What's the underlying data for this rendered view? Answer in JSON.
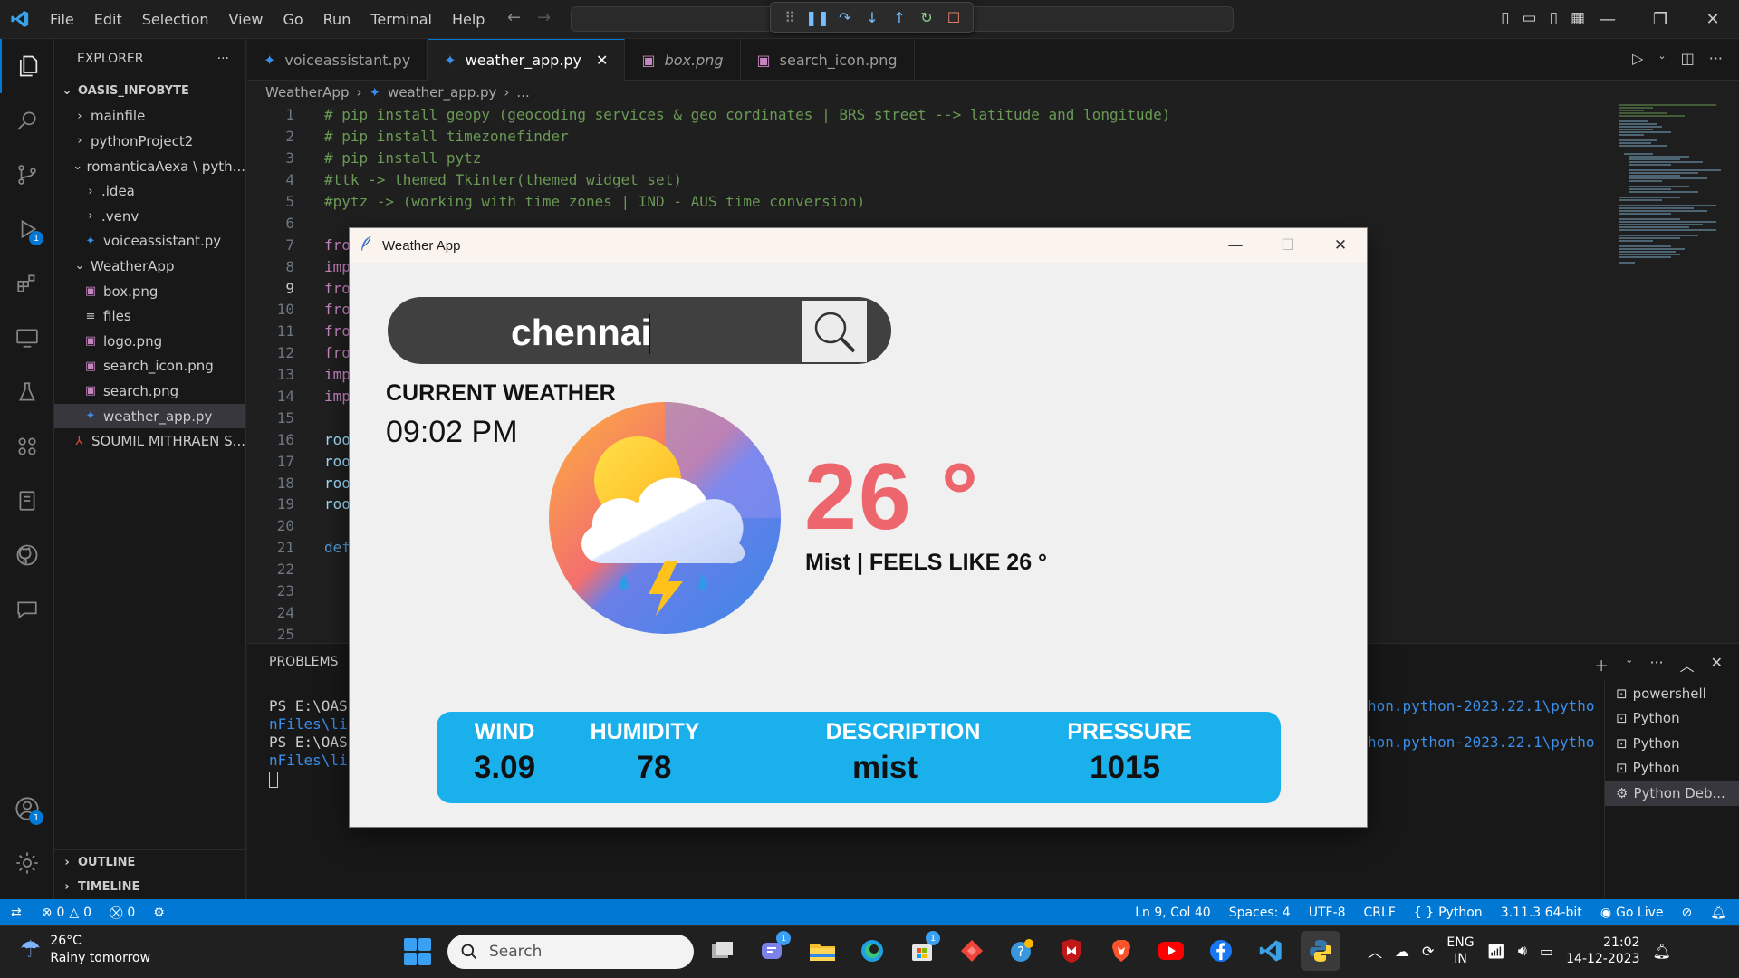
{
  "titlebar": {
    "menu": [
      "File",
      "Edit",
      "Selection",
      "View",
      "Go",
      "Run",
      "Terminal",
      "Help"
    ]
  },
  "activity": {
    "debug_badge": "1",
    "account_badge": "1"
  },
  "explorer": {
    "title": "EXPLORER",
    "more": "···",
    "root": "OASIS_INFOBYTE",
    "tree": [
      {
        "label": "mainfile",
        "kind": "folder-closed",
        "depth": 1
      },
      {
        "label": "pythonProject2",
        "kind": "folder-closed",
        "depth": 1
      },
      {
        "label": "romanticaAexa \\ pyth...",
        "kind": "folder-open",
        "depth": 1
      },
      {
        "label": ".idea",
        "kind": "folder-closed",
        "depth": 2
      },
      {
        "label": ".venv",
        "kind": "folder-closed",
        "depth": 2
      },
      {
        "label": "voiceassistant.py",
        "kind": "py",
        "depth": 2
      },
      {
        "label": "WeatherApp",
        "kind": "folder-open",
        "depth": 1
      },
      {
        "label": "box.png",
        "kind": "png",
        "depth": 2
      },
      {
        "label": "files",
        "kind": "txt",
        "depth": 2
      },
      {
        "label": "logo.png",
        "kind": "png",
        "depth": 2
      },
      {
        "label": "search_icon.png",
        "kind": "png",
        "depth": 2
      },
      {
        "label": "search.png",
        "kind": "png",
        "depth": 2
      },
      {
        "label": "weather_app.py",
        "kind": "py",
        "depth": 2,
        "selected": true
      },
      {
        "label": "SOUMIL MITHRAEN S...",
        "kind": "pdf",
        "depth": 1
      }
    ],
    "outline": "OUTLINE",
    "timeline": "TIMELINE"
  },
  "tabs": [
    {
      "label": "voiceassistant.py",
      "kind": "py"
    },
    {
      "label": "weather_app.py",
      "kind": "py",
      "active": true,
      "close": "✕"
    },
    {
      "label": "box.png",
      "kind": "png",
      "italic": true
    },
    {
      "label": "search_icon.png",
      "kind": "png"
    }
  ],
  "breadcrumb": [
    "WeatherApp",
    "weather_app.py",
    "..."
  ],
  "code": [
    {
      "n": "1",
      "text": "# pip install geopy (geocoding services & geo cordinates | BRS street --> latitude and longitude)",
      "cls": "cm"
    },
    {
      "n": "2",
      "text": "# pip install timezonefinder",
      "cls": "cm"
    },
    {
      "n": "3",
      "text": "# pip install pytz",
      "cls": "cm"
    },
    {
      "n": "4",
      "text": "#ttk -> themed Tkinter(themed widget set)",
      "cls": "cm"
    },
    {
      "n": "5",
      "text": "#pytz -> (working with time zones | IND - AUS time conversion)",
      "cls": "cm"
    },
    {
      "n": "6",
      "text": "",
      "cls": ""
    },
    {
      "n": "7",
      "text": "fro",
      "cls": "kw"
    },
    {
      "n": "8",
      "text": "imp",
      "cls": "kw"
    },
    {
      "n": "9",
      "text": "fro",
      "cls": "kw",
      "current": true
    },
    {
      "n": "10",
      "text": "fro",
      "cls": "kw"
    },
    {
      "n": "11",
      "text": "fro",
      "cls": "kw"
    },
    {
      "n": "12",
      "text": "fro",
      "cls": "kw"
    },
    {
      "n": "13",
      "text": "imp",
      "cls": "kw"
    },
    {
      "n": "14",
      "text": "imp",
      "cls": "kw"
    },
    {
      "n": "15",
      "text": "",
      "cls": ""
    },
    {
      "n": "16",
      "text": "roo",
      "cls": "fn"
    },
    {
      "n": "17",
      "text": "roo",
      "cls": "fn"
    },
    {
      "n": "18",
      "text": "roo",
      "cls": "fn"
    },
    {
      "n": "19",
      "text": "roo",
      "cls": "fn"
    },
    {
      "n": "20",
      "text": "",
      "cls": ""
    },
    {
      "n": "21",
      "text": "def",
      "cls": "kw2"
    },
    {
      "n": "22",
      "text": "",
      "cls": ""
    },
    {
      "n": "23",
      "text": "",
      "cls": ""
    },
    {
      "n": "24",
      "text": "",
      "cls": ""
    },
    {
      "n": "25",
      "text": "",
      "cls": ""
    }
  ],
  "panel": {
    "tab": "PROBLEMS",
    "terminal_left": [
      "PS E:\\OASI",
      "nFiles\\lib",
      "PS E:\\OASI",
      "nFiles\\lib"
    ],
    "terminal_right": [
      "hon.python-2023.22.1\\pytho",
      "",
      "hon.python-2023.22.1\\pytho"
    ],
    "terminals": [
      {
        "label": "powershell",
        "icon": "terminal-icon"
      },
      {
        "label": "Python",
        "icon": "terminal-icon"
      },
      {
        "label": "Python",
        "icon": "terminal-icon"
      },
      {
        "label": "Python",
        "icon": "terminal-icon"
      },
      {
        "label": "Python Deb...",
        "icon": "debug-icon",
        "selected": true
      }
    ]
  },
  "statusbar": {
    "errors": "0",
    "warnings": "0",
    "ports": "0",
    "position": "Ln 9, Col 40",
    "spaces": "Spaces: 4",
    "encoding": "UTF-8",
    "eol": "CRLF",
    "language": "Python",
    "interpreter": "3.11.3 64-bit",
    "golive": "Go Live"
  },
  "taskbar": {
    "weather_temp": "26°C",
    "weather_desc": "Rainy tomorrow",
    "search_placeholder": "Search",
    "lang_line1": "ENG",
    "lang_line2": "IN",
    "time": "21:02",
    "date": "14-12-2023",
    "badge_teams": "1",
    "badge_store": "1"
  },
  "weather_app": {
    "window_title": "Weather App",
    "city": "chennai",
    "current_label": "CURRENT WEATHER",
    "time": "09:02 PM",
    "temperature": "26 °",
    "condition": "Mist | FEELS LIKE 26 °",
    "labels": {
      "wind": "WIND",
      "humidity": "HUMIDITY",
      "description": "DESCRIPTION",
      "pressure": "PRESSURE"
    },
    "values": {
      "wind": "3.09",
      "humidity": "78",
      "description": "mist",
      "pressure": "1015"
    }
  },
  "colors": {
    "accent": "#0078d4",
    "temp": "#ee666d",
    "info_box": "#1ab0ec"
  }
}
